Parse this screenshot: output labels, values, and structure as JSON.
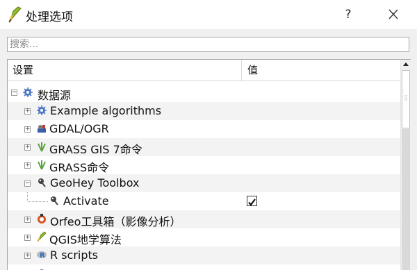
{
  "window": {
    "title": "处理选项",
    "help_label": "?"
  },
  "search": {
    "placeholder": "搜索..."
  },
  "tree": {
    "columns": [
      "设置",
      "值"
    ],
    "rows": [
      {
        "label": "数据源",
        "icon": "gear-icon",
        "expanded": true
      },
      {
        "label": "Example algorithms",
        "icon": "gear-icon",
        "expanded": false
      },
      {
        "label": "GDAL/OGR",
        "icon": "gdal-icon",
        "expanded": false
      },
      {
        "label": "GRASS GIS 7命令",
        "icon": "grass-icon",
        "expanded": false
      },
      {
        "label": "GRASS命令",
        "icon": "grass-icon",
        "expanded": false
      },
      {
        "label": "GeoHey Toolbox",
        "icon": "geohey-icon",
        "expanded": true
      },
      {
        "label": "Activate",
        "icon": "geohey-icon",
        "checked": true
      },
      {
        "label": "Orfeo工具箱（影像分析）",
        "icon": "orfeo-icon",
        "expanded": false
      },
      {
        "label": "QGIS地学算法",
        "icon": "qgis-icon",
        "expanded": false
      },
      {
        "label": "R scripts",
        "icon": "r-icon",
        "expanded": false
      }
    ]
  },
  "colors": {
    "accent_gear": "#4a78c4",
    "grass_green": "#5aa33f",
    "r_blue": "#276dc3"
  }
}
